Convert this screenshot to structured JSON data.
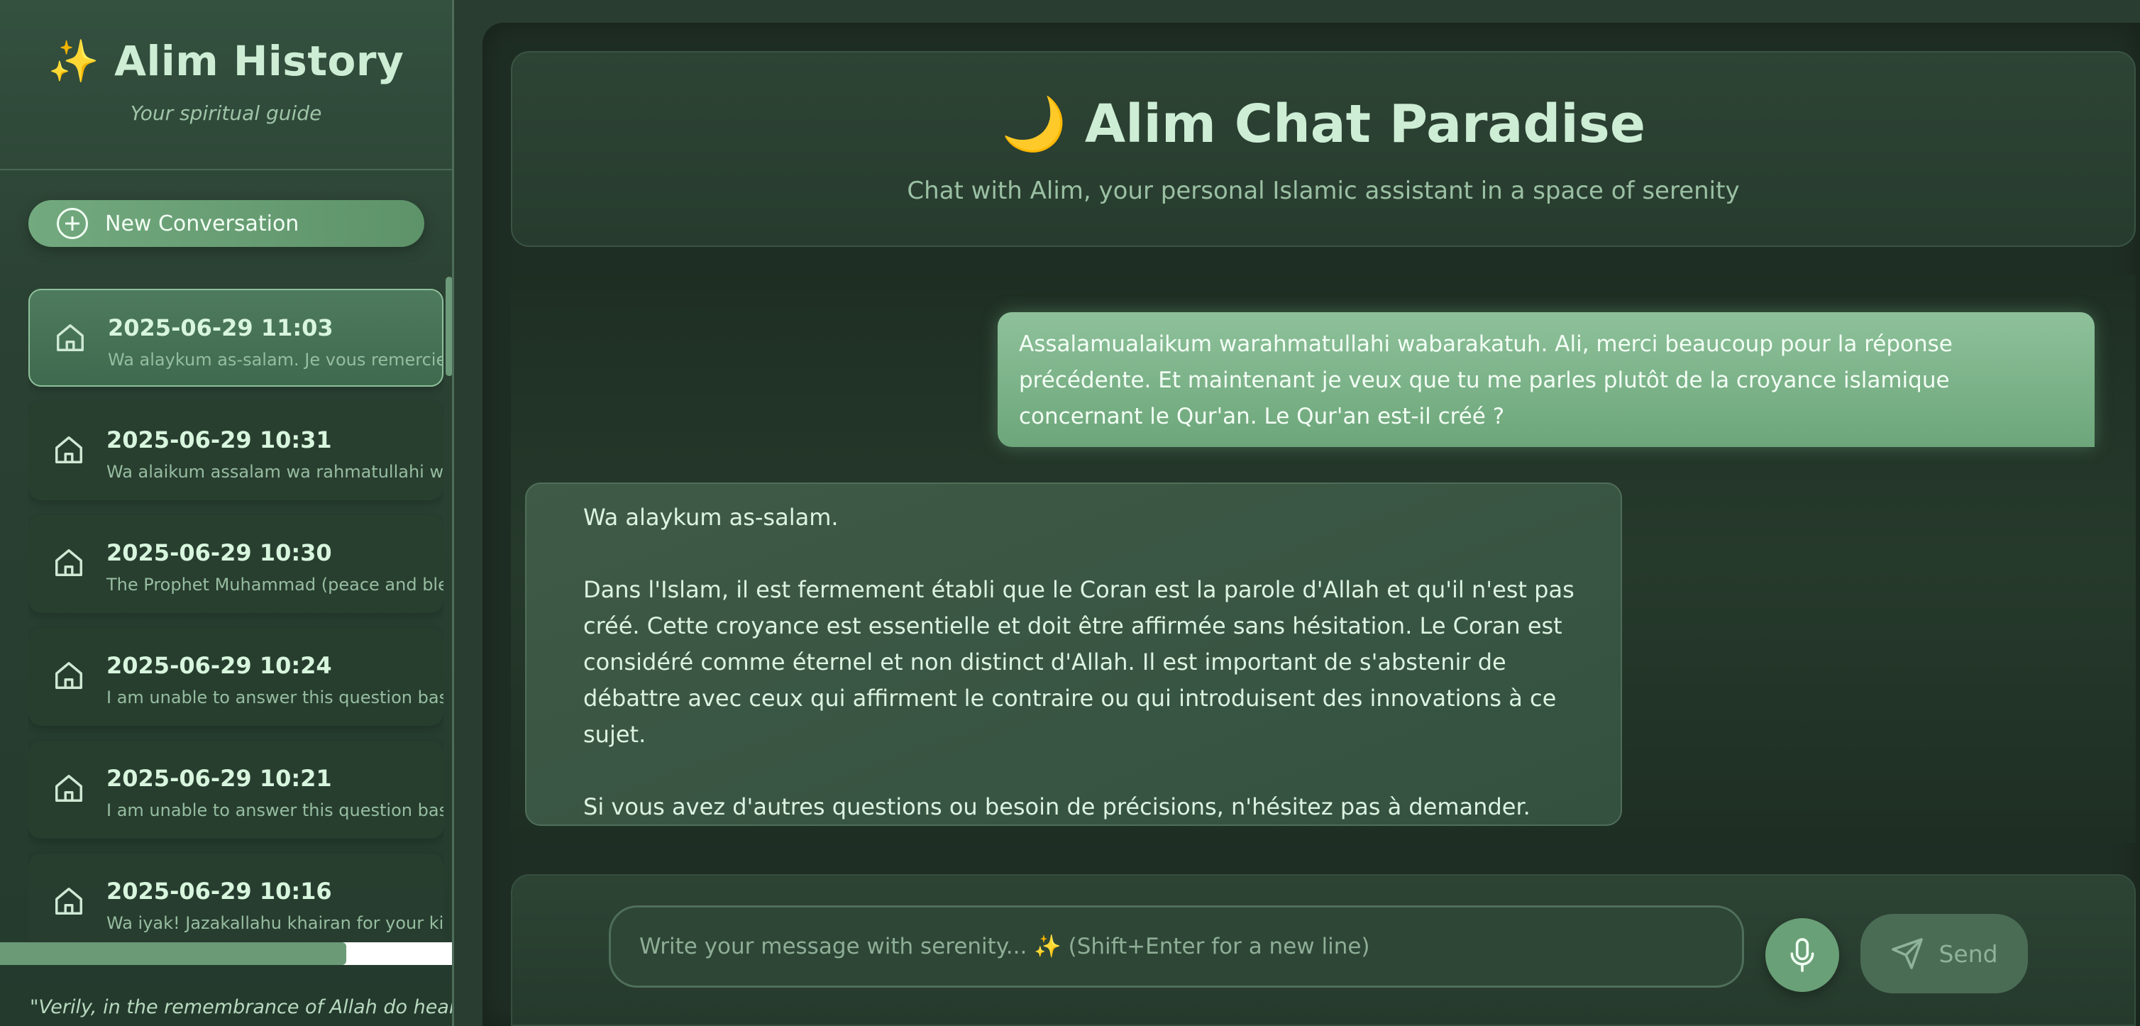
{
  "sidebar": {
    "title": "✨ Alim History",
    "subtitle": "Your spiritual guide",
    "new_conversation": "New Conversation",
    "conversations": [
      {
        "date": "2025-06-29 11:03",
        "preview": "Wa alaykum as-salam. Je vous remercie pour",
        "active": true
      },
      {
        "date": "2025-06-29 10:31",
        "preview": "Wa alaikum assalam wa rahmatullahi wa barakatuh",
        "active": false
      },
      {
        "date": "2025-06-29 10:30",
        "preview": "The Prophet Muhammad (peace and blessings",
        "active": false
      },
      {
        "date": "2025-06-29 10:24",
        "preview": "I am unable to answer this question based",
        "active": false
      },
      {
        "date": "2025-06-29 10:21",
        "preview": "I am unable to answer this question based",
        "active": false
      },
      {
        "date": "2025-06-29 10:16",
        "preview": "Wa iyak! Jazakallahu khairan for your kind",
        "active": false
      }
    ],
    "quote": "\"Verily, in the remembrance of Allah do hearts"
  },
  "header": {
    "title": "🌙 Alim Chat Paradise",
    "subtitle": "Chat with Alim, your personal Islamic assistant in a space of serenity"
  },
  "messages": {
    "user": "Assalamualaikum warahmatullahi wabarakatuh. Ali, merci beaucoup pour la réponse précédente. Et maintenant je veux que tu me parles plutôt de la croyance islamique concernant le Qur'an. Le Qur'an est-il créé ?",
    "assistant": {
      "p1": "Wa alaykum as-salam.",
      "p2": "Dans l'Islam, il est fermement établi que le Coran est la parole d'Allah et qu'il n'est pas créé. Cette croyance est essentielle et doit être affirmée sans hésitation. Le Coran est considéré comme éternel et non distinct d'Allah. Il est important de s'abstenir de débattre avec ceux qui affirment le contraire ou qui introduisent des innovations à ce sujet.",
      "p3": "Si vous avez d'autres questions ou besoin de précisions, n'hésitez pas à demander."
    }
  },
  "composer": {
    "placeholder": "Write your message with serenity... ✨ (Shift+Enter for a new line)",
    "send_label": "Send"
  },
  "icons": {
    "conversation": "home-icon",
    "new": "plus-circle-icon",
    "mic": "microphone-icon",
    "send": "paper-plane-icon"
  },
  "colors": {
    "accent": "#6da67a",
    "background": "#1f2e24",
    "text": "#d8f0dc"
  }
}
